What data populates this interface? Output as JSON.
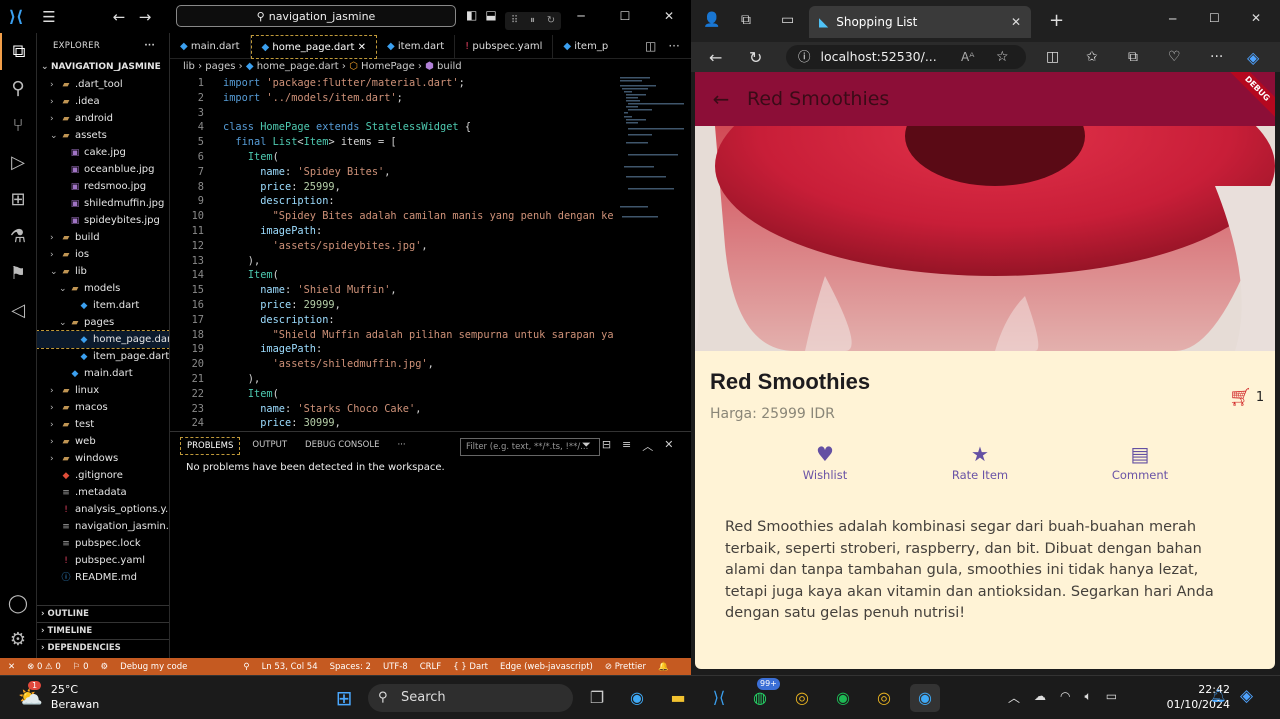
{
  "vscode": {
    "search": "navigation_jasmine",
    "explorer_title": "EXPLORER",
    "root": "NAVIGATION_JASMINE",
    "tree": [
      {
        "label": ".dart_tool",
        "indent": 1,
        "caret": "›",
        "icon": "folder-icon"
      },
      {
        "label": ".idea",
        "indent": 1,
        "caret": "›",
        "icon": "folder-icon"
      },
      {
        "label": "android",
        "indent": 1,
        "caret": "›",
        "icon": "folder-icon"
      },
      {
        "label": "assets",
        "indent": 1,
        "caret": "⌄",
        "icon": "folder-icon"
      },
      {
        "label": "cake.jpg",
        "indent": 2,
        "caret": "",
        "icon": "image-icon"
      },
      {
        "label": "oceanblue.jpg",
        "indent": 2,
        "caret": "",
        "icon": "image-icon"
      },
      {
        "label": "redsmoo.jpg",
        "indent": 2,
        "caret": "",
        "icon": "image-icon"
      },
      {
        "label": "shiledmuffin.jpg",
        "indent": 2,
        "caret": "",
        "icon": "image-icon"
      },
      {
        "label": "spideybites.jpg",
        "indent": 2,
        "caret": "",
        "icon": "image-icon"
      },
      {
        "label": "build",
        "indent": 1,
        "caret": "›",
        "icon": "folder-icon"
      },
      {
        "label": "ios",
        "indent": 1,
        "caret": "›",
        "icon": "folder-icon"
      },
      {
        "label": "lib",
        "indent": 1,
        "caret": "⌄",
        "icon": "folder-icon"
      },
      {
        "label": "models",
        "indent": 2,
        "caret": "⌄",
        "icon": "folder-icon"
      },
      {
        "label": "item.dart",
        "indent": 3,
        "caret": "",
        "icon": "dart-icon"
      },
      {
        "label": "pages",
        "indent": 2,
        "caret": "⌄",
        "icon": "folder-icon"
      },
      {
        "label": "home_page.dart",
        "indent": 3,
        "caret": "",
        "icon": "dart-icon",
        "selected": true
      },
      {
        "label": "item_page.dart",
        "indent": 3,
        "caret": "",
        "icon": "dart-icon"
      },
      {
        "label": "main.dart",
        "indent": 2,
        "caret": "",
        "icon": "dart-icon"
      },
      {
        "label": "linux",
        "indent": 1,
        "caret": "›",
        "icon": "folder-icon"
      },
      {
        "label": "macos",
        "indent": 1,
        "caret": "›",
        "icon": "folder-icon"
      },
      {
        "label": "test",
        "indent": 1,
        "caret": "›",
        "icon": "folder-icon"
      },
      {
        "label": "web",
        "indent": 1,
        "caret": "›",
        "icon": "folder-icon"
      },
      {
        "label": "windows",
        "indent": 1,
        "caret": "›",
        "icon": "folder-icon"
      },
      {
        "label": ".gitignore",
        "indent": 1,
        "caret": "",
        "icon": "git-icon"
      },
      {
        "label": ".metadata",
        "indent": 1,
        "caret": "",
        "icon": "file-icon"
      },
      {
        "label": "analysis_options.y...",
        "indent": 1,
        "caret": "",
        "icon": "yaml-icon"
      },
      {
        "label": "navigation_jasmin...",
        "indent": 1,
        "caret": "",
        "icon": "file-icon"
      },
      {
        "label": "pubspec.lock",
        "indent": 1,
        "caret": "",
        "icon": "file-icon"
      },
      {
        "label": "pubspec.yaml",
        "indent": 1,
        "caret": "",
        "icon": "yaml-icon"
      },
      {
        "label": "README.md",
        "indent": 1,
        "caret": "",
        "icon": "info-icon"
      }
    ],
    "sections": [
      "OUTLINE",
      "TIMELINE",
      "DEPENDENCIES"
    ],
    "tabs": [
      "main.dart",
      "home_page.dart",
      "item.dart",
      "pubspec.yaml",
      "item_p"
    ],
    "breadcrumb": [
      "lib",
      "pages",
      "home_page.dart",
      "HomePage",
      "build"
    ],
    "code": [
      [
        [
          "kw",
          "import "
        ],
        [
          "st",
          "'package:flutter/material.dart'"
        ],
        [
          "tx",
          ";"
        ]
      ],
      [
        [
          "kw",
          "import "
        ],
        [
          "st",
          "'../models/item.dart'"
        ],
        [
          "tx",
          ";"
        ]
      ],
      [],
      [
        [
          "kw",
          "class "
        ],
        [
          "cls",
          "HomePage "
        ],
        [
          "kw",
          "extends "
        ],
        [
          "cls",
          "StatelessWidget "
        ],
        [
          "tx",
          "{"
        ]
      ],
      [
        [
          "tx",
          "  "
        ],
        [
          "kw",
          "final "
        ],
        [
          "cls",
          "List"
        ],
        [
          "tx",
          "<"
        ],
        [
          "cls",
          "Item"
        ],
        [
          "tx",
          "> items = ["
        ]
      ],
      [
        [
          "tx",
          "    "
        ],
        [
          "cls",
          "Item"
        ],
        [
          "tx",
          "("
        ]
      ],
      [
        [
          "tx",
          "      "
        ],
        [
          "pr",
          "name"
        ],
        [
          "tx",
          ": "
        ],
        [
          "st",
          "'Spidey Bites'"
        ],
        [
          "tx",
          ","
        ]
      ],
      [
        [
          "tx",
          "      "
        ],
        [
          "pr",
          "price"
        ],
        [
          "tx",
          ": "
        ],
        [
          "nm",
          "25999"
        ],
        [
          "tx",
          ","
        ]
      ],
      [
        [
          "tx",
          "      "
        ],
        [
          "pr",
          "description"
        ],
        [
          "tx",
          ":"
        ]
      ],
      [
        [
          "tx",
          "        "
        ],
        [
          "st",
          "\"Spidey Bites adalah camilan manis yang penuh dengan ke"
        ]
      ],
      [
        [
          "tx",
          "      "
        ],
        [
          "pr",
          "imagePath"
        ],
        [
          "tx",
          ":"
        ]
      ],
      [
        [
          "tx",
          "        "
        ],
        [
          "st",
          "'assets/spideybites.jpg'"
        ],
        [
          "tx",
          ","
        ]
      ],
      [
        [
          "tx",
          "    ),"
        ]
      ],
      [
        [
          "tx",
          "    "
        ],
        [
          "cls",
          "Item"
        ],
        [
          "tx",
          "("
        ]
      ],
      [
        [
          "tx",
          "      "
        ],
        [
          "pr",
          "name"
        ],
        [
          "tx",
          ": "
        ],
        [
          "st",
          "'Shield Muffin'"
        ],
        [
          "tx",
          ","
        ]
      ],
      [
        [
          "tx",
          "      "
        ],
        [
          "pr",
          "price"
        ],
        [
          "tx",
          ": "
        ],
        [
          "nm",
          "29999"
        ],
        [
          "tx",
          ","
        ]
      ],
      [
        [
          "tx",
          "      "
        ],
        [
          "pr",
          "description"
        ],
        [
          "tx",
          ":"
        ]
      ],
      [
        [
          "tx",
          "        "
        ],
        [
          "st",
          "\"Shield Muffin adalah pilihan sempurna untuk sarapan ya"
        ]
      ],
      [
        [
          "tx",
          "      "
        ],
        [
          "pr",
          "imagePath"
        ],
        [
          "tx",
          ":"
        ]
      ],
      [
        [
          "tx",
          "        "
        ],
        [
          "st",
          "'assets/shiledmuffin.jpg'"
        ],
        [
          "tx",
          ","
        ]
      ],
      [
        [
          "tx",
          "    ),"
        ]
      ],
      [
        [
          "tx",
          "    "
        ],
        [
          "cls",
          "Item"
        ],
        [
          "tx",
          "("
        ]
      ],
      [
        [
          "tx",
          "      "
        ],
        [
          "pr",
          "name"
        ],
        [
          "tx",
          ": "
        ],
        [
          "st",
          "'Starks Choco Cake'"
        ],
        [
          "tx",
          ","
        ]
      ],
      [
        [
          "tx",
          "      "
        ],
        [
          "pr",
          "price"
        ],
        [
          "tx",
          ": "
        ],
        [
          "nm",
          "30999"
        ],
        [
          "tx",
          ","
        ]
      ]
    ],
    "panel_tabs": [
      "PROBLEMS",
      "OUTPUT",
      "DEBUG CONSOLE",
      "···"
    ],
    "filter_placeholder": "Filter (e.g. text, **/*.ts, !**/...",
    "problems_message": "No problems have been detected in the workspace.",
    "status": [
      "⊗ 0 ⚠ 0",
      "⚐ 0",
      "Debug my code",
      "Ln 53, Col 54",
      "Spaces: 2",
      "UTF-8",
      "CRLF",
      "{ } Dart",
      "Edge (web-javascript)",
      "⊘ Prettier"
    ]
  },
  "edge": {
    "tab_title": "Shopping List",
    "url": "localhost:52530/...",
    "app_title": "Red Smoothies",
    "debug_badge": "DEBUG",
    "item_name": "Red Smoothies",
    "price": "Harga: 25999 IDR",
    "cart_count": "1",
    "actions": [
      {
        "label": "Wishlist",
        "icon": "heart-icon"
      },
      {
        "label": "Rate Item",
        "icon": "star-icon"
      },
      {
        "label": "Comment",
        "icon": "comment-icon"
      }
    ],
    "description": "Red Smoothies adalah kombinasi segar dari buah-buahan merah terbaik, seperti stroberi, raspberry, dan bit. Dibuat dengan bahan alami dan tanpa tambahan gula, smoothies ini tidak hanya lezat, tetapi juga kaya akan vitamin dan antioksidan. Segarkan hari Anda dengan satu gelas penuh nutrisi!"
  },
  "taskbar": {
    "weather_temp": "25°C",
    "weather_desc": "Berawan",
    "weather_badge": "1",
    "search_label": "Search",
    "whatsapp_badge": "99+",
    "time": "22:42",
    "date": "01/10/2024"
  }
}
